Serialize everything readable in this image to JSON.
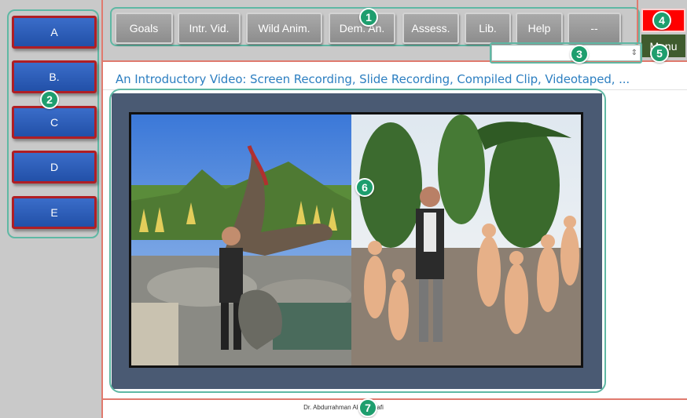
{
  "sidebar": {
    "buttons": [
      "A",
      "B.",
      "C",
      "D",
      "E"
    ]
  },
  "toolbar": {
    "buttons": [
      "Goals",
      "Intr. Vid.",
      "Wild Anim.",
      "Dem. An.",
      "Assess.",
      "Lib.",
      "Help",
      "--"
    ]
  },
  "right": {
    "red_label": "",
    "menu_label": "Menu"
  },
  "selector": {
    "value": ""
  },
  "main": {
    "title": "An Introductory Video: Screen Recording, Slide Recording, Compiled Clip, Videotaped, ..."
  },
  "footer": {
    "author": "Dr. Abdurrahman Al-Mekhlafi"
  },
  "annotations": [
    "1",
    "2",
    "3",
    "4",
    "5",
    "6",
    "7"
  ],
  "colors": {
    "sidebar_button": "#2a5bb8",
    "sidebar_button_border": "#b01e24",
    "toolbar_button": "#9a9a9a",
    "panel_bg": "#4a5a73",
    "title_text": "#2d7fc1",
    "annotation": "#1e9e6e",
    "annotation_outline": "#5fb8a4",
    "divider": "#e07a6e",
    "red_button": "#ff0000",
    "menu_button": "#3f5b2e"
  }
}
